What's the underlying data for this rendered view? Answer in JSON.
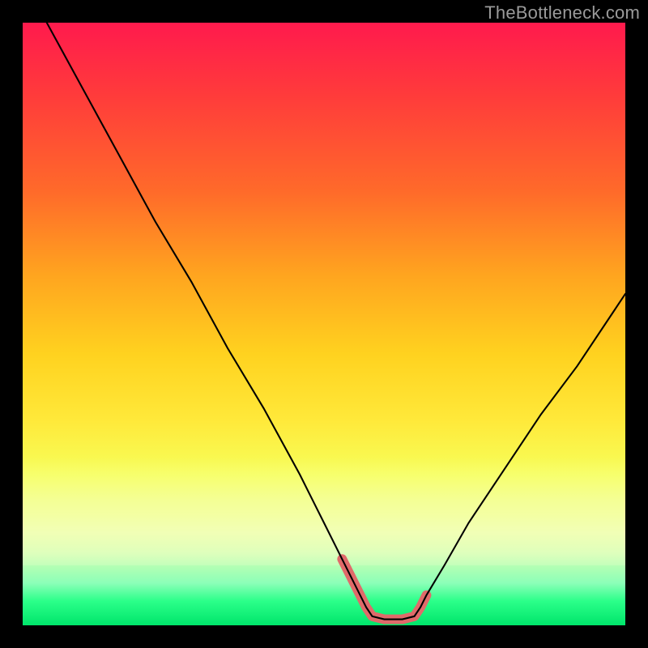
{
  "watermark": "TheBottleneck.com",
  "chart_data": {
    "type": "line",
    "title": "",
    "xlabel": "",
    "ylabel": "",
    "xlim": [
      0,
      100
    ],
    "ylim": [
      0,
      100
    ],
    "background_gradient": {
      "top_color": "#ff1a4d",
      "mid_color": "#ffd21f",
      "bottom_color": "#00e56b"
    },
    "series": [
      {
        "name": "bottleneck-curve",
        "color": "#000000",
        "stroke_width": 2,
        "x": [
          4,
          10,
          16,
          22,
          28,
          34,
          40,
          46,
          50,
          53,
          56,
          57,
          58,
          60,
          63,
          65,
          66,
          67,
          70,
          74,
          80,
          86,
          92,
          98,
          100
        ],
        "y": [
          100,
          89,
          78,
          67,
          57,
          46,
          36,
          25,
          17,
          11,
          5,
          3,
          1.5,
          1,
          1,
          1.5,
          3,
          5,
          10,
          17,
          26,
          35,
          43,
          52,
          55
        ]
      }
    ],
    "highlight": {
      "name": "optimal-range",
      "color": "#e06a6a",
      "stroke_width": 10,
      "x": [
        53,
        56,
        57,
        58,
        60,
        63,
        65,
        66,
        67
      ],
      "y": [
        11,
        5,
        3,
        1.5,
        1,
        1,
        1.5,
        3,
        5
      ]
    }
  }
}
